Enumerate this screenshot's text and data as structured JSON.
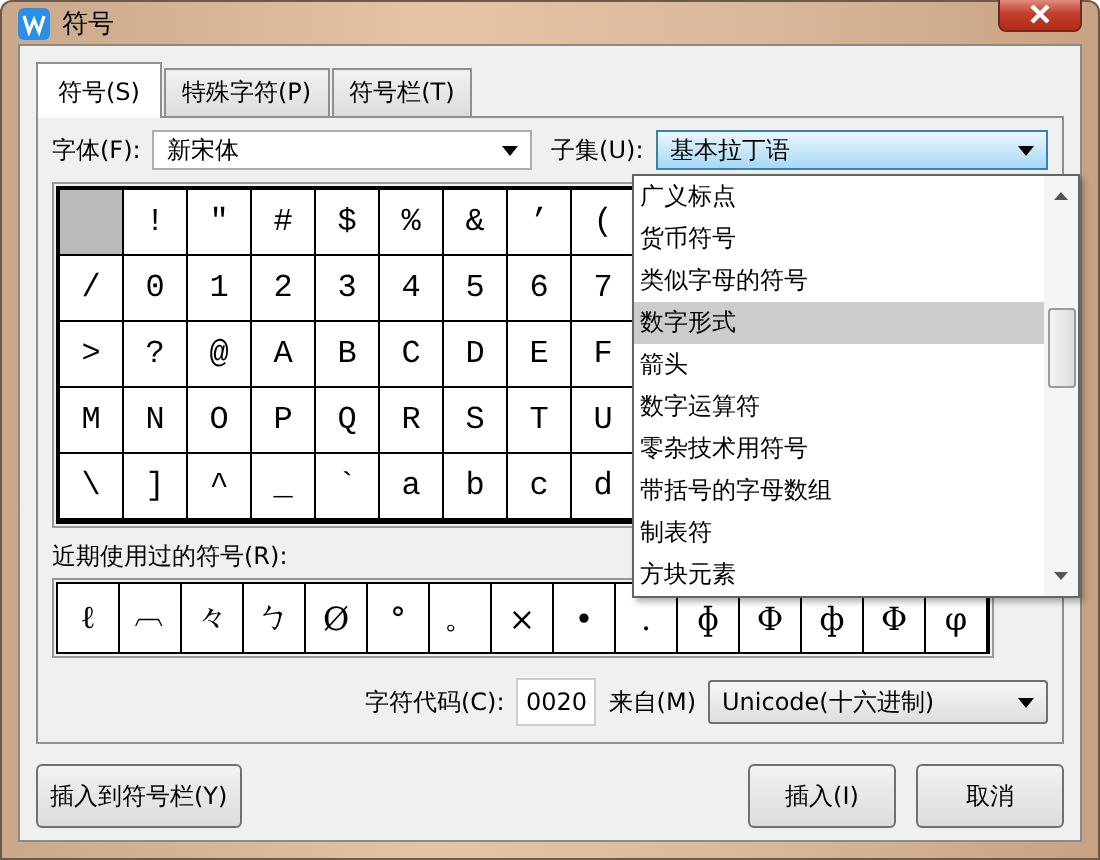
{
  "window": {
    "title": "符号"
  },
  "tabs": [
    {
      "label": "符号(S)",
      "selected": true
    },
    {
      "label": "特殊字符(P)",
      "selected": false
    },
    {
      "label": "符号栏(T)",
      "selected": false
    }
  ],
  "font": {
    "label": "字体(F):",
    "value": "新宋体"
  },
  "subset": {
    "label": "子集(U):",
    "value": "基本拉丁语",
    "expanded": true,
    "options": [
      {
        "label": "广义标点",
        "selected": false
      },
      {
        "label": "货币符号",
        "selected": false
      },
      {
        "label": "类似字母的符号",
        "selected": false
      },
      {
        "label": "数字形式",
        "selected": true
      },
      {
        "label": "箭头",
        "selected": false
      },
      {
        "label": "数字运算符",
        "selected": false
      },
      {
        "label": "零杂技术用符号",
        "selected": false
      },
      {
        "label": "带括号的字母数组",
        "selected": false
      },
      {
        "label": "制表符",
        "selected": false
      },
      {
        "label": "方块元素",
        "selected": false
      }
    ]
  },
  "symbol_grid": {
    "rows": [
      [
        {
          "selected": true
        },
        {
          "symbol": "!",
          "selected": false
        },
        {
          "symbol": "″",
          "selected": false
        },
        {
          "symbol": "#",
          "selected": false
        },
        {
          "symbol": "$",
          "selected": false
        },
        {
          "symbol": "%",
          "selected": false
        },
        {
          "symbol": "&",
          "selected": false
        },
        {
          "symbol": "’",
          "selected": false
        },
        {
          "symbol": "(",
          "selected": false
        }
      ],
      [
        {
          "symbol": "/",
          "selected": false
        },
        {
          "symbol": "0",
          "selected": false
        },
        {
          "symbol": "1",
          "selected": false
        },
        {
          "symbol": "2",
          "selected": false
        },
        {
          "symbol": "3",
          "selected": false
        },
        {
          "symbol": "4",
          "selected": false
        },
        {
          "symbol": "5",
          "selected": false
        },
        {
          "symbol": "6",
          "selected": false
        },
        {
          "symbol": "7",
          "selected": false
        }
      ],
      [
        {
          "symbol": ">",
          "selected": false
        },
        {
          "symbol": "?",
          "selected": false
        },
        {
          "symbol": "@",
          "selected": false
        },
        {
          "symbol": "A",
          "selected": false
        },
        {
          "symbol": "B",
          "selected": false
        },
        {
          "symbol": "C",
          "selected": false
        },
        {
          "symbol": "D",
          "selected": false
        },
        {
          "symbol": "E",
          "selected": false
        },
        {
          "symbol": "F",
          "selected": false
        }
      ],
      [
        {
          "symbol": "M",
          "selected": false
        },
        {
          "symbol": "N",
          "selected": false
        },
        {
          "symbol": "O",
          "selected": false
        },
        {
          "symbol": "P",
          "selected": false
        },
        {
          "symbol": "Q",
          "selected": false
        },
        {
          "symbol": "R",
          "selected": false
        },
        {
          "symbol": "S",
          "selected": false
        },
        {
          "symbol": "T",
          "selected": false
        },
        {
          "symbol": "U",
          "selected": false
        }
      ],
      [
        {
          "symbol": "\\",
          "selected": false
        },
        {
          "symbol": "]",
          "selected": false
        },
        {
          "symbol": "^",
          "selected": false
        },
        {
          "symbol": "_",
          "selected": false
        },
        {
          "symbol": "`",
          "selected": false
        },
        {
          "symbol": "a",
          "selected": false
        },
        {
          "symbol": "b",
          "selected": false
        },
        {
          "symbol": "c",
          "selected": false
        },
        {
          "symbol": "d",
          "selected": false
        }
      ]
    ]
  },
  "recent": {
    "label": "近期使用过的符号(R):",
    "symbols": [
      "ℓ",
      "︹",
      "々",
      "ㄅ",
      "Ø",
      "°",
      "。",
      "×",
      "•",
      ".",
      "ɸ",
      "Ф",
      "ф",
      "Φ",
      "φ"
    ]
  },
  "char_code": {
    "label": "字符代码(C):",
    "value": "0020"
  },
  "from": {
    "label": "来自(M)",
    "value": "Unicode(十六进制)"
  },
  "buttons": [
    {
      "label": "插入到符号栏(Y)"
    },
    {
      "label": "插入(I)"
    },
    {
      "label": "取消"
    }
  ]
}
